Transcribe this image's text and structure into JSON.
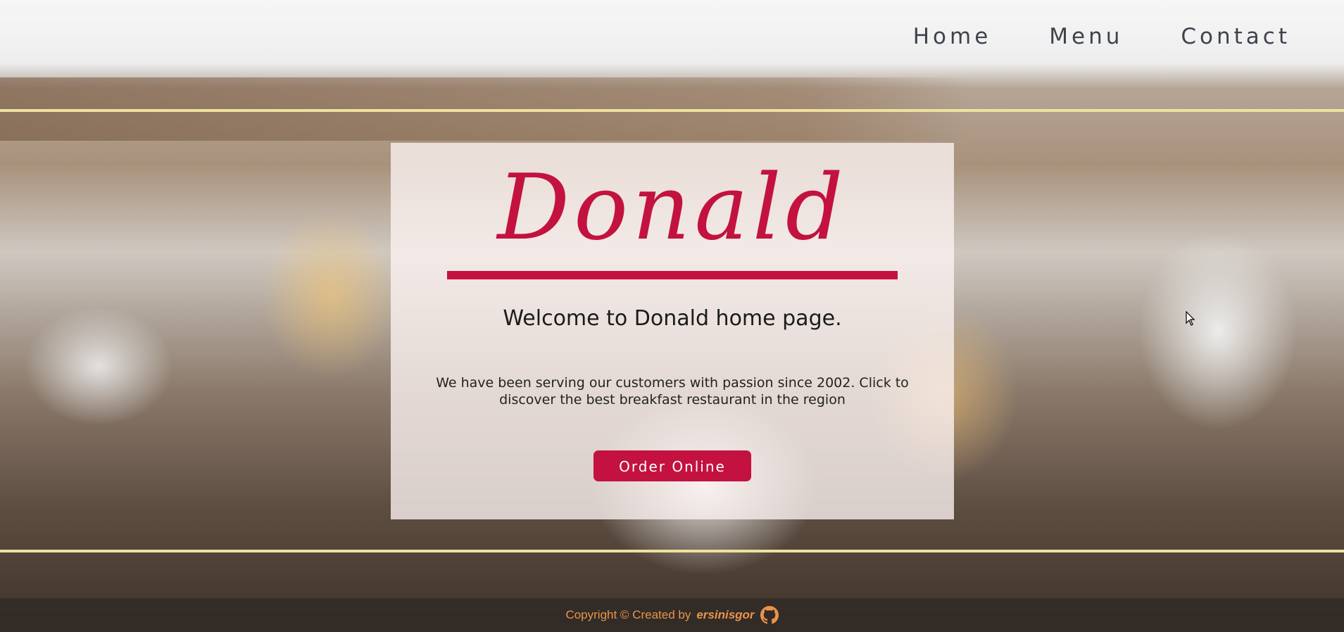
{
  "nav": {
    "items": [
      {
        "label": "Home"
      },
      {
        "label": "Menu"
      },
      {
        "label": "Contact"
      }
    ]
  },
  "hero": {
    "brand": "Donald",
    "welcome": "Welcome to Donald home page.",
    "description": "We have been serving our customers with passion since 2002. Click to discover the best breakfast restaurant in the region",
    "cta_label": "Order Online"
  },
  "footer": {
    "prefix": "Copyright © Created by",
    "author": "ersinisgor",
    "icon": "github-icon"
  },
  "colors": {
    "accent": "#c3123f",
    "rule": "#ede29f",
    "footer_text": "#e8954a",
    "nav_text": "#3e434c"
  }
}
